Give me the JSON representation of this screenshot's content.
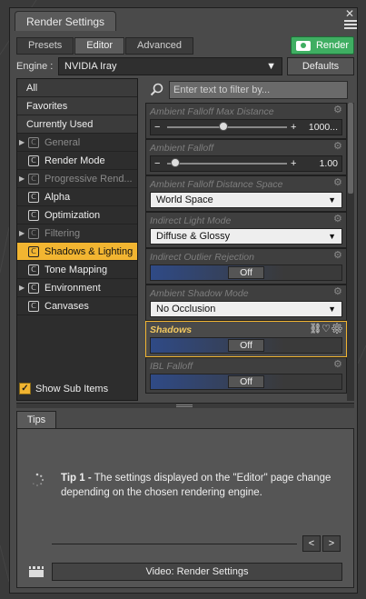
{
  "window": {
    "title": "Render Settings",
    "close_glyph": "✕"
  },
  "tabs": [
    {
      "label": "Presets",
      "active": false
    },
    {
      "label": "Editor",
      "active": true
    },
    {
      "label": "Advanced",
      "active": false
    }
  ],
  "render_button": {
    "label": "Render",
    "color": "#3fae62"
  },
  "engine": {
    "label": "Engine :",
    "value": "NVIDIA Iray",
    "defaults_label": "Defaults"
  },
  "left_list": {
    "groups": [
      "All",
      "Favorites",
      "Currently Used"
    ],
    "items": [
      {
        "label": "General",
        "expandable": true,
        "dim": true,
        "selected": false
      },
      {
        "label": "Render Mode",
        "expandable": false,
        "dim": false,
        "selected": false
      },
      {
        "label": "Progressive Rend...",
        "expandable": true,
        "dim": true,
        "selected": false
      },
      {
        "label": "Alpha",
        "expandable": false,
        "dim": false,
        "selected": false
      },
      {
        "label": "Optimization",
        "expandable": false,
        "dim": false,
        "selected": false
      },
      {
        "label": "Filtering",
        "expandable": true,
        "dim": true,
        "selected": false
      },
      {
        "label": "Shadows & Lighting",
        "expandable": false,
        "dim": false,
        "selected": true
      },
      {
        "label": "Tone Mapping",
        "expandable": false,
        "dim": false,
        "selected": false
      },
      {
        "label": "Environment",
        "expandable": true,
        "dim": false,
        "selected": false
      },
      {
        "label": "Canvases",
        "expandable": false,
        "dim": false,
        "selected": false
      }
    ],
    "show_sub_items": {
      "label": "Show Sub Items",
      "checked": true
    }
  },
  "search": {
    "placeholder": "Enter text to filter by..."
  },
  "properties": [
    {
      "label": "Ambient Falloff Max Distance",
      "type": "slider",
      "value": "1000...",
      "fraction": 0.47
    },
    {
      "label": "Ambient Falloff",
      "type": "slider",
      "value": "1.00",
      "fraction": 0.07
    },
    {
      "label": "Ambient Falloff Distance Space",
      "type": "dropdown",
      "value": "World Space"
    },
    {
      "label": "Indirect Light Mode",
      "type": "dropdown",
      "value": "Diffuse & Glossy"
    },
    {
      "label": "Indirect Outlier Rejection",
      "type": "toggle",
      "value": "Off"
    },
    {
      "label": "Ambient Shadow Mode",
      "type": "dropdown",
      "value": "No Occlusion"
    },
    {
      "label": "Shadows",
      "type": "toggle",
      "value": "Off",
      "highlight": true
    },
    {
      "label": "IBL Falloff",
      "type": "toggle",
      "value": "Off"
    }
  ],
  "tips": {
    "tab_label": "Tips",
    "title": "Tip 1 -",
    "body": "The settings displayed on the \"Editor\" page change depending on the chosen rendering engine.",
    "prev": "<",
    "next": ">",
    "video_label": "Video: Render Settings"
  },
  "colors": {
    "accent": "#f2b531",
    "render_green": "#3fae62"
  }
}
